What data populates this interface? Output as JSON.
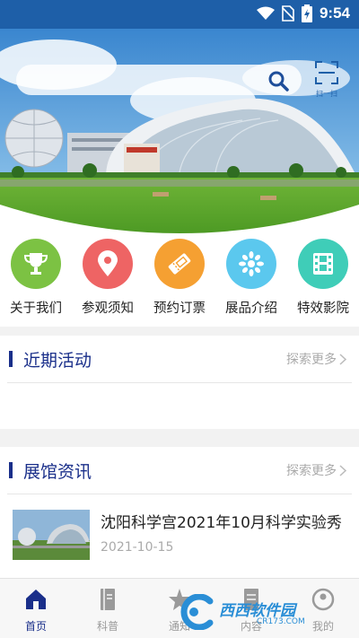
{
  "status_bar": {
    "time": "9:54"
  },
  "header": {
    "scan_label": "扫一扫"
  },
  "quick_nav": [
    {
      "label": "关于我们",
      "icon": "trophy-icon",
      "color": "#7cc243"
    },
    {
      "label": "参观须知",
      "icon": "location-pin-icon",
      "color": "#ee6464"
    },
    {
      "label": "预约订票",
      "icon": "ticket-icon",
      "color": "#f5a032"
    },
    {
      "label": "展品介绍",
      "icon": "flower-icon",
      "color": "#5bc8ee"
    },
    {
      "label": "特效影院",
      "icon": "film-icon",
      "color": "#3fcdb8"
    }
  ],
  "activities": {
    "title": "近期活动",
    "more": "探索更多"
  },
  "hall_news": {
    "title": "展馆资讯",
    "more": "探索更多",
    "items": [
      {
        "title": "沈阳科学宫2021年10月科学实验秀",
        "date": "2021-10-15"
      }
    ]
  },
  "tabbar": [
    {
      "label": "首页",
      "icon": "home-icon",
      "active": true
    },
    {
      "label": "科普",
      "icon": "book-icon",
      "active": false
    },
    {
      "label": "通知",
      "icon": "star-icon",
      "active": false
    },
    {
      "label": "内容",
      "icon": "document-icon",
      "active": false
    },
    {
      "label": "我的",
      "icon": "user-icon",
      "active": false
    }
  ],
  "watermark": {
    "text": "西西软件园",
    "sub": "CR173.COM"
  },
  "colors": {
    "primary": "#1e5fa8",
    "title": "#1a2f8a"
  }
}
